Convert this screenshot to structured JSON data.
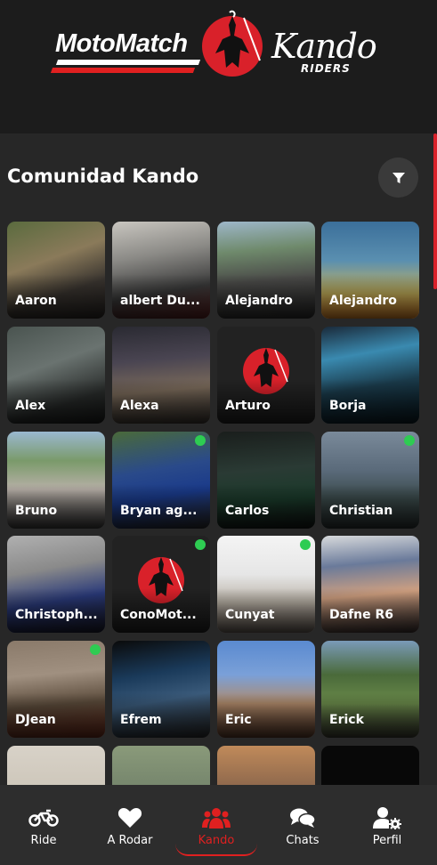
{
  "header": {
    "brand_moto": "MotoMatch",
    "brand_kando": "Kando",
    "brand_riders": "RIDERS"
  },
  "community": {
    "title": "Comunidad Kando",
    "filter_icon": "filter-icon"
  },
  "members": [
    {
      "name": "Aaron",
      "online": false,
      "bg": "linear-gradient(160deg,#5a6b3e 0%,#8a7a5a 40%,#3a3530 70%,#2a2624 100%)"
    },
    {
      "name": "albert Du...",
      "online": false,
      "bg": "linear-gradient(170deg,#c9c6c0 0%,#8b8a86 35%,#3a3a3a 70%,#5a2020 100%)"
    },
    {
      "name": "Alejandro",
      "online": false,
      "bg": "linear-gradient(175deg,#9eb7c9 0%,#6f8a6c 30%,#4a4a48 60%,#2b2b2b 100%)"
    },
    {
      "name": "Alejandro",
      "online": false,
      "bg": "linear-gradient(180deg,#3b6f9a 0%,#5a8fb0 40%,#c8b25a 75%,#e1882a 100%)"
    },
    {
      "name": "Alex",
      "online": false,
      "bg": "linear-gradient(160deg,#4a5450 0%,#6a7370 40%,#2a2d2c 75%,#1a1c1b 100%)"
    },
    {
      "name": "Alexa",
      "online": false,
      "bg": "linear-gradient(175deg,#2a2a32 0%,#4a4552 35%,#7a6a5a 65%,#3a3530 100%)"
    },
    {
      "name": "Arturo",
      "online": false,
      "emblem": true,
      "bg": "#222222"
    },
    {
      "name": "Borja",
      "online": false,
      "bg": "linear-gradient(170deg,#1a2a3a 0%,#3a8ab0 30%,#1a3a4a 60%,#0a1a22 100%)"
    },
    {
      "name": "Bruno",
      "online": false,
      "bg": "linear-gradient(180deg,#9ab8d0 0%,#7a9a6a 30%,#b8b0a8 60%,#3a3a3a 100%)"
    },
    {
      "name": "Bryan ag...",
      "online": true,
      "bg": "linear-gradient(170deg,#4a6a3a 0%,#2a4a8a 40%,#1a3a8a 65%,#2a2a2a 100%)"
    },
    {
      "name": "Carlos",
      "online": false,
      "bg": "linear-gradient(175deg,#1a1e1c 0%,#2a3a34 40%,#1a3a2a 70%,#121614 100%)"
    },
    {
      "name": "Christian",
      "online": true,
      "bg": "linear-gradient(180deg,#7a8a9a 0%,#5a6a7a 40%,#3a4a4a 70%,#2a3030 100%)"
    },
    {
      "name": "Christoph...",
      "online": false,
      "bg": "linear-gradient(170deg,#b0b0b0 0%,#8a8a8a 35%,#2a3a7a 65%,#1a1a2a 100%)"
    },
    {
      "name": "ConoMot...",
      "online": true,
      "emblem": true,
      "bg": "#222222"
    },
    {
      "name": "Cunyat",
      "online": true,
      "bg": "linear-gradient(180deg,#f4f4f4 0%,#e6e6e6 40%,#b8b0a4 70%,#6a6058 100%)"
    },
    {
      "name": "Dafne R6",
      "online": false,
      "bg": "linear-gradient(175deg,#d8dadc 0%,#6a7a9a 30%,#d0a080 60%,#3a3030 100%)"
    },
    {
      "name": "DJean",
      "online": true,
      "bg": "linear-gradient(175deg,#8a7a6a 0%,#a09080 35%,#5a4a3a 65%,#6a2a1a 100%)"
    },
    {
      "name": "Efrem",
      "online": false,
      "bg": "linear-gradient(170deg,#0a0a0a 0%,#1a3a5a 35%,#3a5a7a 60%,#2a2a2a 100%)"
    },
    {
      "name": "Eric",
      "online": false,
      "bg": "linear-gradient(180deg,#5a8ad0 0%,#7aa0d8 35%,#b08a6a 65%,#5a3a2a 100%)"
    },
    {
      "name": "Erick",
      "online": false,
      "bg": "linear-gradient(180deg,#7a9ab8 0%,#4a6a3a 35%,#6a8a4a 65%,#3a3a30 100%)"
    },
    {
      "name": "",
      "online": false,
      "bg": "linear-gradient(180deg,#d8d2c8 0%,#c0b8a8 100%)"
    },
    {
      "name": "",
      "online": false,
      "bg": "linear-gradient(180deg,#8a9a7a 0%,#5a6a5a 100%)"
    },
    {
      "name": "",
      "online": false,
      "bg": "linear-gradient(180deg,#c08a5a 0%,#4a3a3a 100%)"
    },
    {
      "name": "",
      "online": false,
      "bg": "#080808"
    }
  ],
  "nav": [
    {
      "label": "Ride",
      "icon": "motorcycle-icon",
      "active": false
    },
    {
      "label": "A Rodar",
      "icon": "heart-icon",
      "active": false
    },
    {
      "label": "Kando",
      "icon": "users-icon",
      "active": true
    },
    {
      "label": "Chats",
      "icon": "chat-bubbles-icon",
      "active": false
    },
    {
      "label": "Perfil",
      "icon": "user-gear-icon",
      "active": false
    }
  ],
  "colors": {
    "accent": "#e02020",
    "online": "#2ecc52",
    "background": "#272727",
    "header_bg": "#1c1c1c",
    "nav_bg": "#2d2d2d"
  }
}
